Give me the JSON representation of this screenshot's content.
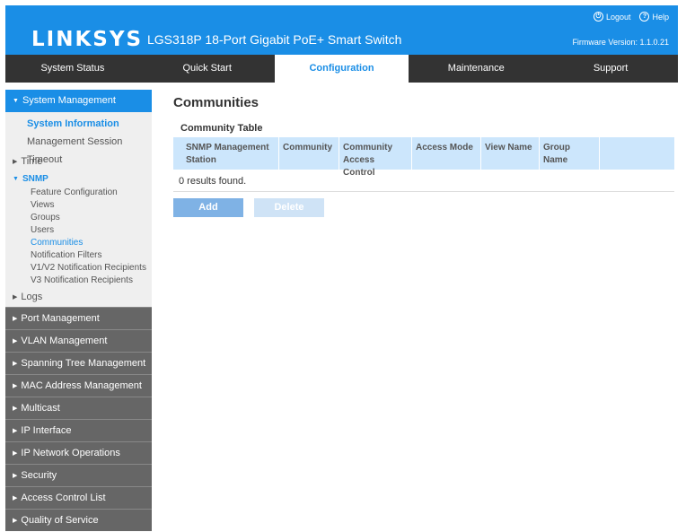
{
  "header": {
    "brand": "LINKSYS",
    "product": "LGS318P 18-Port Gigabit PoE+ Smart Switch",
    "logout": "Logout",
    "help": "Help",
    "firmware": "Firmware Version: 1.1.0.21",
    "colors": {
      "accent": "#1a8ee6",
      "nav": "#333333"
    }
  },
  "nav": {
    "tabs": [
      "System Status",
      "Quick Start",
      "Configuration",
      "Maintenance",
      "Support"
    ],
    "active": "Configuration"
  },
  "sidebar": {
    "system_management": "System Management",
    "system_information": "System Information",
    "management_session_timeout": "Management Session Timeout",
    "time": "Time",
    "snmp": "SNMP",
    "snmp_items": [
      "Feature Configuration",
      "Views",
      "Groups",
      "Users",
      "Communities",
      "Notification Filters",
      "V1/V2 Notification Recipients",
      "V3 Notification Recipients"
    ],
    "logs": "Logs",
    "sections": [
      "Port Management",
      "VLAN Management",
      "Spanning Tree Management",
      "MAC Address Management",
      "Multicast",
      "IP Interface",
      "IP Network Operations",
      "Security",
      "Access Control List",
      "Quality of Service"
    ]
  },
  "main": {
    "title": "Communities",
    "table_title": "Community Table",
    "columns": [
      "SNMP Management Station",
      "Community",
      "Community Access Control",
      "Access Mode",
      "View Name",
      "Group Name"
    ],
    "results": "0 results found.",
    "add": "Add",
    "delete": "Delete"
  }
}
